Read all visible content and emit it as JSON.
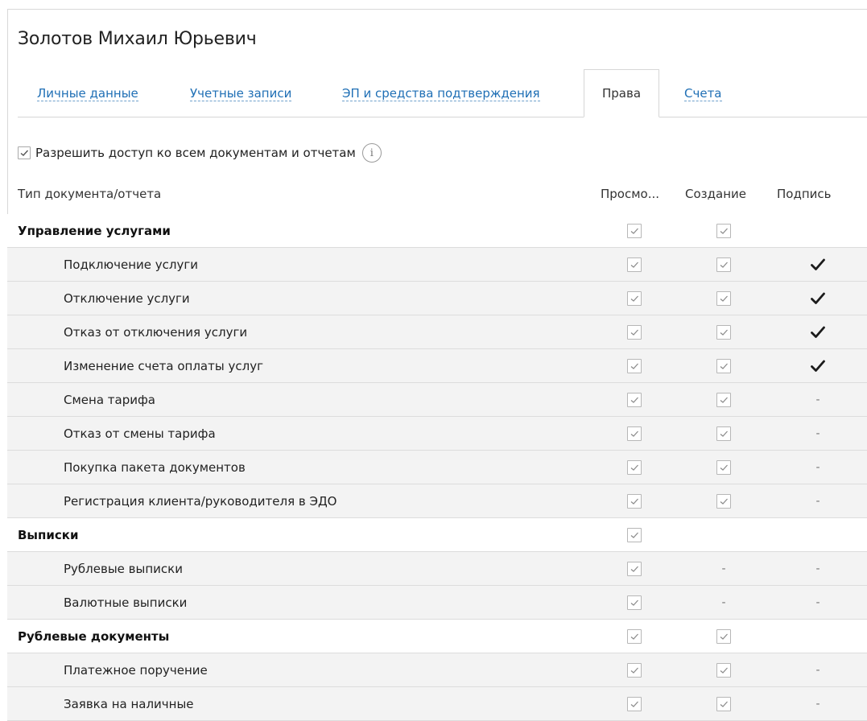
{
  "title": "Золотов Михаил Юрьевич",
  "tabs": [
    {
      "label": "Личные данные",
      "active": false
    },
    {
      "label": "Учетные записи",
      "active": false
    },
    {
      "label": "ЭП и средства подтверждения",
      "active": false
    },
    {
      "label": "Права",
      "active": true
    },
    {
      "label": "Счета",
      "active": false
    }
  ],
  "allow_all": {
    "label": "Разрешить доступ ко всем документам и отчетам",
    "checked": true,
    "info_icon": "i"
  },
  "columns": {
    "type": "Тип документа/отчета",
    "view": "Просмо...",
    "create": "Создание",
    "sign": "Подпись"
  },
  "rows": [
    {
      "kind": "group",
      "name": "Управление услугами",
      "view": "check",
      "create": "check",
      "sign": "none"
    },
    {
      "kind": "item",
      "name": "Подключение услуги",
      "view": "check",
      "create": "check",
      "sign": "mark"
    },
    {
      "kind": "item",
      "name": "Отключение услуги",
      "view": "check",
      "create": "check",
      "sign": "mark"
    },
    {
      "kind": "item",
      "name": "Отказ от отключения услуги",
      "view": "check",
      "create": "check",
      "sign": "mark"
    },
    {
      "kind": "item",
      "name": "Изменение счета оплаты услуг",
      "view": "check",
      "create": "check",
      "sign": "mark"
    },
    {
      "kind": "item",
      "name": "Смена тарифа",
      "view": "check",
      "create": "check",
      "sign": "-"
    },
    {
      "kind": "item",
      "name": "Отказ от смены тарифа",
      "view": "check",
      "create": "check",
      "sign": "-"
    },
    {
      "kind": "item",
      "name": "Покупка пакета документов",
      "view": "check",
      "create": "check",
      "sign": "-"
    },
    {
      "kind": "item",
      "name": "Регистрация клиента/руководителя в ЭДО",
      "view": "check",
      "create": "check",
      "sign": "-"
    },
    {
      "kind": "group",
      "name": "Выписки",
      "view": "check",
      "create": "none",
      "sign": "none"
    },
    {
      "kind": "item",
      "name": "Рублевые выписки",
      "view": "check",
      "create": "-",
      "sign": "-"
    },
    {
      "kind": "item",
      "name": "Валютные выписки",
      "view": "check",
      "create": "-",
      "sign": "-"
    },
    {
      "kind": "group",
      "name": "Рублевые документы",
      "view": "check",
      "create": "check",
      "sign": "none"
    },
    {
      "kind": "item",
      "name": "Платежное поручение",
      "view": "check",
      "create": "check",
      "sign": "-"
    },
    {
      "kind": "item",
      "name": "Заявка на наличные",
      "view": "check",
      "create": "check",
      "sign": "-"
    }
  ]
}
